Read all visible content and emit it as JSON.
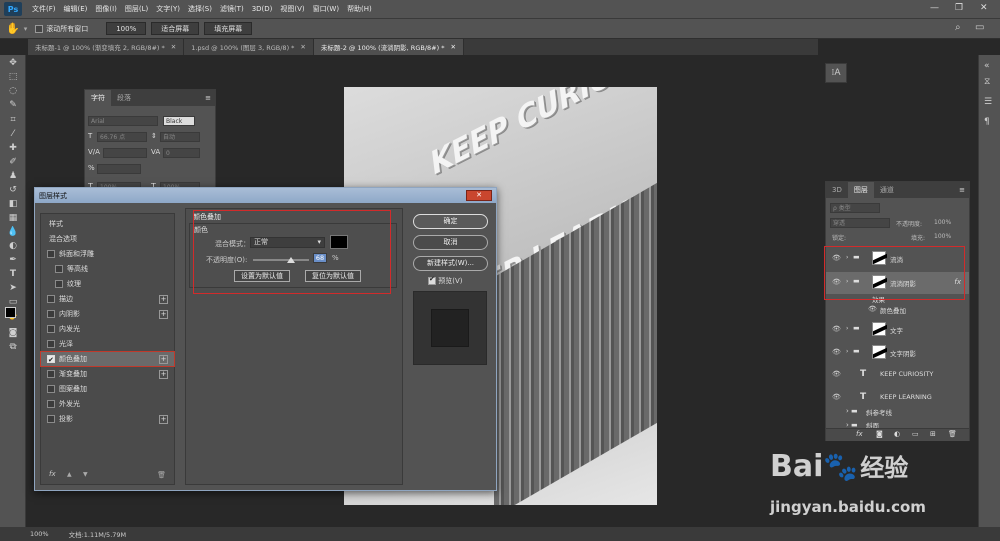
{
  "app": {
    "logo": "Ps"
  },
  "menubar": {
    "items": [
      "文件(F)",
      "编辑(E)",
      "图像(I)",
      "图层(L)",
      "文字(Y)",
      "选择(S)",
      "滤镜(T)",
      "3D(D)",
      "视图(V)",
      "窗口(W)",
      "帮助(H)"
    ],
    "window_controls": [
      "—",
      "❐",
      "✕"
    ]
  },
  "options": {
    "scroll_all_label": "滚动所有窗口",
    "zoom_100": "100%",
    "fit_screen": "适合屏幕",
    "fill_screen": "填充屏幕"
  },
  "doc_tabs": [
    {
      "label": "未标题-1 @ 100% (渐变填充 2, RGB/8#) *",
      "active": false
    },
    {
      "label": "1.psd @ 100% (图层 3, RGB/8) *",
      "active": false
    },
    {
      "label": "未标题-2 @ 100% (流淌阴影, RGB/8#) *",
      "active": true
    }
  ],
  "canvas": {
    "line1": "KEEP CURIOSITY",
    "line2": "KEEP LEARNING"
  },
  "char_panel": {
    "tabs": [
      "字符",
      "段落"
    ],
    "font": "Arial",
    "color_label": "Black",
    "size": "66.76 点",
    "leading": "自动",
    "tracking": "0",
    "scale_v": "100%",
    "scale_h": "100%"
  },
  "dialog": {
    "title": "图层样式",
    "close": "✕",
    "styles_header": "样式",
    "blend_options": "混合选项",
    "items": [
      {
        "label": "斜面和浮雕",
        "checked": false,
        "plus": false,
        "indent": false
      },
      {
        "label": "等高线",
        "checked": false,
        "plus": false,
        "indent": true
      },
      {
        "label": "纹理",
        "checked": false,
        "plus": false,
        "indent": true
      },
      {
        "label": "描边",
        "checked": false,
        "plus": true,
        "indent": false
      },
      {
        "label": "内阴影",
        "checked": false,
        "plus": true,
        "indent": false
      },
      {
        "label": "内发光",
        "checked": false,
        "plus": false,
        "indent": false
      },
      {
        "label": "光泽",
        "checked": false,
        "plus": false,
        "indent": false
      },
      {
        "label": "颜色叠加",
        "checked": true,
        "plus": true,
        "indent": false
      },
      {
        "label": "渐变叠加",
        "checked": false,
        "plus": true,
        "indent": false
      },
      {
        "label": "图案叠加",
        "checked": false,
        "plus": false,
        "indent": false
      },
      {
        "label": "外发光",
        "checked": false,
        "plus": false,
        "indent": false
      },
      {
        "label": "投影",
        "checked": false,
        "plus": true,
        "indent": false
      }
    ],
    "footer_icons": [
      "fx",
      "▲",
      "▼",
      "🗑"
    ],
    "section_title": "颜色叠加",
    "sub_title": "颜色",
    "blend_mode_label": "混合模式：",
    "blend_mode_value": "正常",
    "opacity_label": "不透明度(O):",
    "opacity_value": "68",
    "opacity_unit": "%",
    "set_default": "设置为默认值",
    "reset_default": "复位为默认值",
    "ok": "确定",
    "cancel": "取消",
    "new_style": "新建样式(W)...",
    "preview": "预览(V)",
    "overlay_color": "#000000"
  },
  "layers_panel": {
    "tabs": [
      "3D",
      "图层",
      "通道"
    ],
    "kind_label": "ρ 类型",
    "blend_mode": "穿透",
    "opacity_label": "不透明度:",
    "opacity_value": "100%",
    "lock_label": "锁定:",
    "fill_label": "填充:",
    "fill_value": "100%",
    "layers": [
      {
        "name": "流淌",
        "type": "group-thumb"
      },
      {
        "name": "流淌阴影",
        "type": "group-thumb-selected"
      },
      {
        "name": "效果",
        "type": "effect"
      },
      {
        "name": "颜色叠加",
        "type": "effect-item"
      },
      {
        "name": "文字",
        "type": "group-thumb"
      },
      {
        "name": "文字阴影",
        "type": "group-thumb"
      },
      {
        "name": "KEEP CURIOSITY",
        "type": "text"
      },
      {
        "name": "KEEP LEARNING",
        "type": "text"
      },
      {
        "name": "斜参考线",
        "type": "folder"
      },
      {
        "name": "斜面",
        "type": "folder"
      }
    ],
    "fx": "fx"
  },
  "status": {
    "zoom": "100%",
    "doc": "文档:1.11M/5.79M"
  },
  "watermark": {
    "brand1": "Bai",
    "brand2": "经验",
    "url": "jingyan.baidu.com"
  }
}
